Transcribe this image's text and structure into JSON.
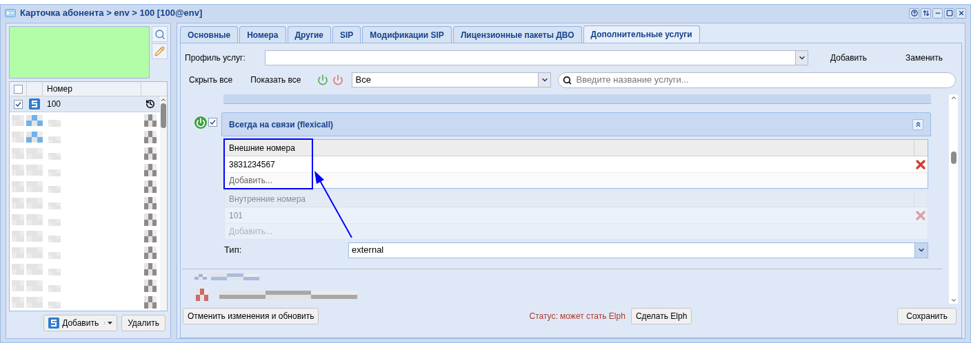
{
  "window": {
    "title": "Карточка абонента > env > 100 [100@env]"
  },
  "left_panel": {
    "column": "Номер",
    "all_checked": false,
    "rows": [
      {
        "number": "100",
        "checked": true,
        "selected": true
      }
    ],
    "add_button": "Добавить",
    "delete_button": "Удалить"
  },
  "tabs": [
    {
      "label": "Основные",
      "selected": false
    },
    {
      "label": "Номера",
      "selected": false
    },
    {
      "label": "Другие",
      "selected": false
    },
    {
      "label": "SIP",
      "selected": false
    },
    {
      "label": "Модификации SIP",
      "selected": false
    },
    {
      "label": "Лицензионные пакеты ДВО",
      "selected": false
    },
    {
      "label": "Дополнительные услуги",
      "selected": true
    }
  ],
  "profile": {
    "label": "Профиль услуг:",
    "add": "Добавить",
    "replace": "Заменить"
  },
  "toolbar": {
    "hide_all": "Скрыть все",
    "show_all": "Показать все",
    "filter": "Все",
    "search_placeholder": "Введите название услуги..."
  },
  "service": {
    "title": "Всегда на связи (flexicall)",
    "on": true,
    "checked": true,
    "expanded": true,
    "grids": [
      {
        "header": "Внешние номера",
        "rows": [
          "3831234567"
        ],
        "add_hint": "Добавить...",
        "disabled": false
      },
      {
        "header": "Внутренние номера",
        "rows": [
          "101"
        ],
        "add_hint": "Добавить...",
        "disabled": true
      }
    ],
    "type_label": "Тип:",
    "type_value": "external"
  },
  "footer": {
    "cancel": "Отменить изменения и обновить",
    "status": "Статус: может стать Elph",
    "make_elph": "Сделать Elph",
    "save": "Сохранить"
  }
}
